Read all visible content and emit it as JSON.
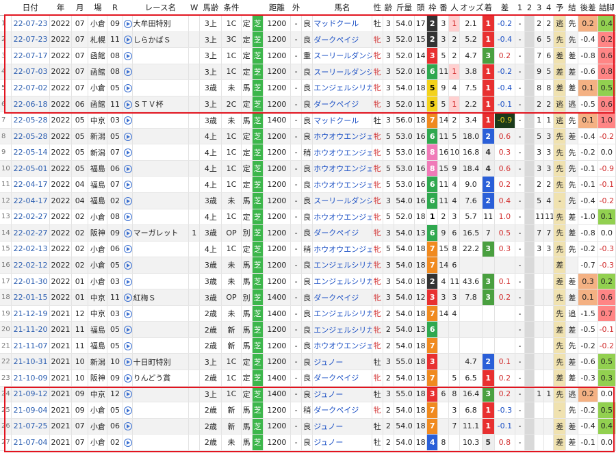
{
  "columns": [
    "",
    "日付",
    "年",
    "月",
    "場",
    "R",
    "",
    "レース名",
    "W",
    "馬齢",
    "条件",
    "",
    "",
    "距離",
    "外",
    "",
    "馬名",
    "性",
    "齢",
    "斤量",
    "頭",
    "枠",
    "番",
    "人",
    "オッズ",
    "着",
    "差",
    "1",
    "2",
    "3",
    "4",
    "予",
    "結",
    "後差",
    "詰脚"
  ],
  "frame_colors": {
    "1": "#ffffff",
    "2": "#333333",
    "3": "#e83030",
    "4": "#2a5fd8",
    "5": "#f3d21c",
    "6": "#2fa84f",
    "7": "#f08a20",
    "8": "#f07ab8"
  },
  "finish_colors": {
    "1": "#e83030",
    "2": "#2a5fd8",
    "3": "#4aa040",
    "4": "#eeeeee",
    "5": "#eeeeee"
  },
  "rows": [
    {
      "n": "1",
      "date": "22-07-23",
      "y": "2022",
      "m": "07",
      "place": "小倉",
      "r": "09",
      "race": "大牟田特別",
      "w": "",
      "age": "3上",
      "cls": "1C",
      "t1": "定",
      "t2": "芝",
      "dist": "1200",
      "out": "-",
      "cond": "良",
      "horse": "マッドクール",
      "sex": "牡",
      "hage": "3",
      "kg": "54.0",
      "heads": "17",
      "frame": "2",
      "num": "3",
      "pop": "1",
      "odds": "2.1",
      "fin": "1",
      "diff": "-0.2",
      "c1": "-",
      "c2": "",
      "c3": "2",
      "c4": "2",
      "pred": "逃",
      "res": "先",
      "ato": "0.2",
      "ato_c": "#f4b183",
      "tsume": "0.4",
      "tsume_c": "#92d050"
    },
    {
      "n": "2",
      "date": "22-07-23",
      "y": "2022",
      "m": "07",
      "place": "札幌",
      "r": "11",
      "race": "しらかばＳ",
      "w": "",
      "age": "3上",
      "cls": "3C",
      "t1": "定",
      "t2": "芝",
      "dist": "1200",
      "out": "-",
      "cond": "良",
      "horse": "ダークペイジ",
      "sex": "牝",
      "hage": "3",
      "kg": "52.0",
      "heads": "15",
      "frame": "2",
      "num": "3",
      "pop": "2",
      "odds": "5.2",
      "fin": "1",
      "diff": "-0.4",
      "c1": "-",
      "c2": "",
      "c3": "6",
      "c4": "5",
      "pred": "先",
      "res": "先",
      "ato": "-0.4",
      "ato_c": "#ffffff",
      "tsume": "0.2",
      "tsume_c": "#ff8585"
    },
    {
      "n": "3",
      "date": "22-07-17",
      "y": "2022",
      "m": "07",
      "place": "函館",
      "r": "08",
      "race": "",
      "w": "",
      "age": "3上",
      "cls": "1C",
      "t1": "定",
      "t2": "芝",
      "dist": "1200",
      "out": "-",
      "cond": "重",
      "horse": "スーリールダンジュ",
      "sex": "牝",
      "hage": "3",
      "kg": "52.0",
      "heads": "14",
      "frame": "3",
      "num": "5",
      "pop": "2",
      "odds": "4.7",
      "fin": "3",
      "diff": "0.2",
      "c1": "-",
      "c2": "",
      "c3": "7",
      "c4": "6",
      "pred": "差",
      "res": "差",
      "ato": "-0.8",
      "ato_c": "#ffffff",
      "tsume": "0.6",
      "tsume_c": "#ff8585"
    },
    {
      "n": "4",
      "date": "22-07-03",
      "y": "2022",
      "m": "07",
      "place": "函館",
      "r": "08",
      "race": "",
      "w": "",
      "age": "3上",
      "cls": "1C",
      "t1": "定",
      "t2": "芝",
      "dist": "1200",
      "out": "-",
      "cond": "良",
      "horse": "スーリールダンジュ",
      "sex": "牝",
      "hage": "3",
      "kg": "52.0",
      "heads": "16",
      "frame": "6",
      "num": "11",
      "pop": "1",
      "odds": "3.8",
      "fin": "1",
      "diff": "-0.2",
      "c1": "-",
      "c2": "",
      "c3": "9",
      "c4": "5",
      "pred": "差",
      "res": "差",
      "ato": "-0.6",
      "ato_c": "#ffffff",
      "tsume": "0.8",
      "tsume_c": "#ff8585"
    },
    {
      "n": "5",
      "date": "22-07-02",
      "y": "2022",
      "m": "07",
      "place": "小倉",
      "r": "05",
      "race": "",
      "w": "",
      "age": "3歳",
      "cls": "未",
      "t1": "馬",
      "t2": "芝",
      "dist": "1200",
      "out": "-",
      "cond": "良",
      "horse": "エンジェルシリカ",
      "sex": "牝",
      "hage": "3",
      "kg": "54.0",
      "heads": "18",
      "frame": "5",
      "num": "9",
      "pop": "4",
      "odds": "7.5",
      "fin": "1",
      "diff": "-0.4",
      "c1": "-",
      "c2": "",
      "c3": "8",
      "c4": "8",
      "pred": "差",
      "res": "差",
      "ato": "0.1",
      "ato_c": "#f4b183",
      "tsume": "0.5",
      "tsume_c": "#92d050"
    },
    {
      "n": "6",
      "date": "22-06-18",
      "y": "2022",
      "m": "06",
      "place": "函館",
      "r": "11",
      "race": "ＳＴＶ杯",
      "w": "",
      "age": "3上",
      "cls": "2C",
      "t1": "定",
      "t2": "芝",
      "dist": "1200",
      "out": "-",
      "cond": "良",
      "horse": "ダークペイジ",
      "sex": "牝",
      "hage": "3",
      "kg": "52.0",
      "heads": "11",
      "frame": "5",
      "num": "5",
      "pop": "1",
      "odds": "2.2",
      "fin": "1",
      "diff": "-0.1",
      "c1": "-",
      "c2": "",
      "c3": "2",
      "c4": "2",
      "pred": "逃",
      "res": "逃",
      "ato": "-0.5",
      "ato_c": "#ffffff",
      "tsume": "0.6",
      "tsume_c": "#ff8585"
    },
    {
      "n": "7",
      "date": "22-05-28",
      "y": "2022",
      "m": "05",
      "place": "中京",
      "r": "03",
      "race": "",
      "w": "",
      "age": "3歳",
      "cls": "未",
      "t1": "馬",
      "t2": "芝",
      "dist": "1400",
      "out": "-",
      "cond": "良",
      "horse": "マッドクール",
      "sex": "牡",
      "hage": "3",
      "kg": "56.0",
      "heads": "18",
      "frame": "7",
      "num": "14",
      "pop": "2",
      "odds": "3.4",
      "fin": "1",
      "diff": "-0.9",
      "c1": "-",
      "c2": "",
      "c3": "1",
      "c4": "1",
      "pred": "逃",
      "res": "先",
      "ato": "0.1",
      "ato_c": "#f4b183",
      "tsume": "1.0",
      "tsume_c": "#ff8585"
    },
    {
      "n": "8",
      "date": "22-05-28",
      "y": "2022",
      "m": "05",
      "place": "新潟",
      "r": "05",
      "race": "",
      "w": "",
      "age": "4上",
      "cls": "1C",
      "t1": "定",
      "t2": "芝",
      "dist": "1200",
      "out": "-",
      "cond": "良",
      "horse": "ホウオウエンジェル",
      "sex": "牝",
      "hage": "5",
      "kg": "53.0",
      "heads": "16",
      "frame": "6",
      "num": "11",
      "pop": "5",
      "odds": "18.0",
      "fin": "2",
      "diff": "0.6",
      "c1": "-",
      "c2": "",
      "c3": "5",
      "c4": "3",
      "pred": "先",
      "res": "差",
      "ato": "-0.4",
      "ato_c": "#ffffff",
      "tsume": "-0.2",
      "tsume_c": "#ffffff"
    },
    {
      "n": "9",
      "date": "22-05-14",
      "y": "2022",
      "m": "05",
      "place": "新潟",
      "r": "07",
      "race": "",
      "w": "",
      "age": "4上",
      "cls": "1C",
      "t1": "定",
      "t2": "芝",
      "dist": "1200",
      "out": "-",
      "cond": "稍",
      "horse": "ホウオウエンジェル",
      "sex": "牝",
      "hage": "5",
      "kg": "53.0",
      "heads": "16",
      "frame": "8",
      "num": "16",
      "pop": "10",
      "odds": "16.8",
      "fin": "4",
      "diff": "0.3",
      "c1": "-",
      "c2": "",
      "c3": "3",
      "c4": "3",
      "pred": "先",
      "res": "先",
      "ato": "-0.2",
      "ato_c": "#ffffff",
      "tsume": "0.0",
      "tsume_c": "#ffffff"
    },
    {
      "n": "10",
      "date": "22-05-01",
      "y": "2022",
      "m": "05",
      "place": "福島",
      "r": "06",
      "race": "",
      "w": "",
      "age": "4上",
      "cls": "1C",
      "t1": "定",
      "t2": "芝",
      "dist": "1200",
      "out": "-",
      "cond": "良",
      "horse": "ホウオウエンジェル",
      "sex": "牝",
      "hage": "5",
      "kg": "53.0",
      "heads": "16",
      "frame": "8",
      "num": "15",
      "pop": "9",
      "odds": "18.4",
      "fin": "4",
      "diff": "0.6",
      "c1": "-",
      "c2": "",
      "c3": "3",
      "c4": "3",
      "pred": "先",
      "res": "先",
      "ato": "-0.1",
      "ato_c": "#ffffff",
      "tsume": "-0.9",
      "tsume_c": "#ffffff"
    },
    {
      "n": "11",
      "date": "22-04-17",
      "y": "2022",
      "m": "04",
      "place": "福島",
      "r": "07",
      "race": "",
      "w": "",
      "age": "4上",
      "cls": "1C",
      "t1": "定",
      "t2": "芝",
      "dist": "1200",
      "out": "-",
      "cond": "良",
      "horse": "ホウオウエンジェル",
      "sex": "牝",
      "hage": "5",
      "kg": "53.0",
      "heads": "16",
      "frame": "6",
      "num": "11",
      "pop": "4",
      "odds": "9.0",
      "fin": "2",
      "diff": "0.2",
      "c1": "-",
      "c2": "",
      "c3": "2",
      "c4": "2",
      "pred": "先",
      "res": "先",
      "ato": "-0.1",
      "ato_c": "#ffffff",
      "tsume": "-0.1",
      "tsume_c": "#ffffff"
    },
    {
      "n": "12",
      "date": "22-04-17",
      "y": "2022",
      "m": "04",
      "place": "福島",
      "r": "02",
      "race": "",
      "w": "",
      "age": "3歳",
      "cls": "未",
      "t1": "馬",
      "t2": "芝",
      "dist": "1200",
      "out": "-",
      "cond": "良",
      "horse": "スーリールダンジュ",
      "sex": "牝",
      "hage": "3",
      "kg": "54.0",
      "heads": "16",
      "frame": "6",
      "num": "11",
      "pop": "4",
      "odds": "7.6",
      "fin": "2",
      "diff": "0.4",
      "c1": "-",
      "c2": "",
      "c3": "5",
      "c4": "4",
      "pred": "-",
      "res": "先",
      "ato": "-0.4",
      "ato_c": "#ffffff",
      "tsume": "-0.2",
      "tsume_c": "#ffffff"
    },
    {
      "n": "13",
      "date": "22-02-27",
      "y": "2022",
      "m": "02",
      "place": "小倉",
      "r": "08",
      "race": "",
      "w": "",
      "age": "4上",
      "cls": "1C",
      "t1": "定",
      "t2": "芝",
      "dist": "1200",
      "out": "-",
      "cond": "良",
      "horse": "ホウオウエンジェル",
      "sex": "牝",
      "hage": "5",
      "kg": "52.0",
      "heads": "18",
      "frame": "1",
      "num": "2",
      "pop": "3",
      "odds": "5.7",
      "fin": "11",
      "diff": "1.0",
      "c1": "-",
      "c2": "",
      "c3": "11",
      "c4": "11",
      "pred": "先",
      "res": "差",
      "ato": "-1.0",
      "ato_c": "#ffffff",
      "tsume": "0.1",
      "tsume_c": "#92d050"
    },
    {
      "n": "14",
      "date": "22-02-27",
      "y": "2022",
      "m": "02",
      "place": "阪神",
      "r": "09",
      "race": "マーガレット",
      "w": "1",
      "age": "3歳",
      "cls": "OP",
      "t1": "別",
      "t2": "芝",
      "dist": "1200",
      "out": "-",
      "cond": "良",
      "horse": "ダークペイジ",
      "sex": "牝",
      "hage": "3",
      "kg": "54.0",
      "heads": "13",
      "frame": "6",
      "num": "9",
      "pop": "6",
      "odds": "16.5",
      "fin": "7",
      "diff": "0.5",
      "c1": "-",
      "c2": "",
      "c3": "7",
      "c4": "7",
      "pred": "先",
      "res": "差",
      "ato": "-0.8",
      "ato_c": "#ffffff",
      "tsume": "0.0",
      "tsume_c": "#ffffff"
    },
    {
      "n": "15",
      "date": "22-02-13",
      "y": "2022",
      "m": "02",
      "place": "小倉",
      "r": "06",
      "race": "",
      "w": "",
      "age": "4上",
      "cls": "1C",
      "t1": "定",
      "t2": "芝",
      "dist": "1200",
      "out": "-",
      "cond": "稍",
      "horse": "ホウオウエンジェル",
      "sex": "牝",
      "hage": "5",
      "kg": "54.0",
      "heads": "18",
      "frame": "7",
      "num": "15",
      "pop": "8",
      "odds": "22.2",
      "fin": "3",
      "diff": "0.3",
      "c1": "-",
      "c2": "",
      "c3": "3",
      "c4": "3",
      "pred": "先",
      "res": "先",
      "ato": "-0.2",
      "ato_c": "#ffffff",
      "tsume": "-0.3",
      "tsume_c": "#ffffff"
    },
    {
      "n": "16",
      "date": "22-02-12",
      "y": "2022",
      "m": "02",
      "place": "小倉",
      "r": "05",
      "race": "",
      "w": "",
      "age": "3歳",
      "cls": "未",
      "t1": "馬",
      "t2": "芝",
      "dist": "1200",
      "out": "-",
      "cond": "良",
      "horse": "エンジェルシリカ",
      "sex": "牝",
      "hage": "3",
      "kg": "54.0",
      "heads": "18",
      "frame": "7",
      "num": "14",
      "pop": "6",
      "odds": "",
      "fin": "",
      "diff": "",
      "c1": "-",
      "c2": "",
      "c3": "",
      "c4": "",
      "pred": "差",
      "res": "",
      "ato": "-0.7",
      "ato_c": "#ffffff",
      "tsume": "-0.3",
      "tsume_c": "#ffffff"
    },
    {
      "n": "17",
      "date": "22-01-30",
      "y": "2022",
      "m": "01",
      "place": "小倉",
      "r": "03",
      "race": "",
      "w": "",
      "age": "3歳",
      "cls": "未",
      "t1": "馬",
      "t2": "芝",
      "dist": "1200",
      "out": "-",
      "cond": "良",
      "horse": "エンジェルシリカ",
      "sex": "牝",
      "hage": "3",
      "kg": "54.0",
      "heads": "18",
      "frame": "2",
      "num": "4",
      "pop": "11",
      "odds": "43.6",
      "fin": "3",
      "diff": "0.1",
      "c1": "-",
      "c2": "",
      "c3": "",
      "c4": "",
      "pred": "差",
      "res": "差",
      "ato": "0.3",
      "ato_c": "#f4b183",
      "tsume": "0.2",
      "tsume_c": "#92d050"
    },
    {
      "n": "18",
      "date": "22-01-15",
      "y": "2022",
      "m": "01",
      "place": "中京",
      "r": "11",
      "race": "紅梅Ｓ",
      "w": "",
      "age": "3歳",
      "cls": "OP",
      "t1": "別",
      "t2": "芝",
      "dist": "1400",
      "out": "-",
      "cond": "良",
      "horse": "ダークペイジ",
      "sex": "牝",
      "hage": "3",
      "kg": "54.0",
      "heads": "12",
      "frame": "3",
      "num": "3",
      "pop": "3",
      "odds": "7.8",
      "fin": "3",
      "diff": "0.2",
      "c1": "-",
      "c2": "",
      "c3": "",
      "c4": "",
      "pred": "先",
      "res": "差",
      "ato": "0.1",
      "ato_c": "#f4b183",
      "tsume": "0.6",
      "tsume_c": "#ff8585"
    },
    {
      "n": "19",
      "date": "21-12-19",
      "y": "2021",
      "m": "12",
      "place": "中京",
      "r": "03",
      "race": "",
      "w": "",
      "age": "2歳",
      "cls": "未",
      "t1": "馬",
      "t2": "芝",
      "dist": "1400",
      "out": "-",
      "cond": "良",
      "horse": "エンジェルシリカ",
      "sex": "牝",
      "hage": "2",
      "kg": "54.0",
      "heads": "18",
      "frame": "7",
      "num": "14",
      "pop": "4",
      "odds": "",
      "fin": "",
      "diff": "",
      "c1": "-",
      "c2": "",
      "c3": "",
      "c4": "",
      "pred": "先",
      "res": "追",
      "ato": "-1.5",
      "ato_c": "#ffffff",
      "tsume": "0.7",
      "tsume_c": "#ff8585"
    },
    {
      "n": "20",
      "date": "21-11-20",
      "y": "2021",
      "m": "11",
      "place": "福島",
      "r": "05",
      "race": "",
      "w": "",
      "age": "2歳",
      "cls": "新",
      "t1": "馬",
      "t2": "芝",
      "dist": "1200",
      "out": "-",
      "cond": "良",
      "horse": "エンジェルシリカ",
      "sex": "牝",
      "hage": "2",
      "kg": "54.0",
      "heads": "13",
      "frame": "6",
      "num": "",
      "pop": "",
      "odds": "",
      "fin": "",
      "diff": "",
      "c1": "-",
      "c2": "",
      "c3": "",
      "c4": "",
      "pred": "差",
      "res": "差",
      "ato": "-0.5",
      "ato_c": "#ffffff",
      "tsume": "-0.1",
      "tsume_c": "#ffffff"
    },
    {
      "n": "21",
      "date": "21-11-07",
      "y": "2021",
      "m": "11",
      "place": "福島",
      "r": "05",
      "race": "",
      "w": "",
      "age": "2歳",
      "cls": "新",
      "t1": "馬",
      "t2": "芝",
      "dist": "1200",
      "out": "-",
      "cond": "良",
      "horse": "ホウオウエンジェル",
      "sex": "牝",
      "hage": "2",
      "kg": "54.0",
      "heads": "18",
      "frame": "7",
      "num": "",
      "pop": "",
      "odds": "",
      "fin": "",
      "diff": "",
      "c1": "-",
      "c2": "",
      "c3": "",
      "c4": "",
      "pred": "先",
      "res": "先",
      "ato": "-0.2",
      "ato_c": "#ffffff",
      "tsume": "-0.2",
      "tsume_c": "#ffffff"
    },
    {
      "n": "22",
      "date": "21-10-31",
      "y": "2021",
      "m": "10",
      "place": "新潟",
      "r": "10",
      "race": "十日町特別",
      "w": "",
      "age": "3上",
      "cls": "1C",
      "t1": "定",
      "t2": "芝",
      "dist": "1200",
      "out": "-",
      "cond": "良",
      "horse": "ジュノー",
      "sex": "牡",
      "hage": "3",
      "kg": "55.0",
      "heads": "18",
      "frame": "3",
      "num": "",
      "pop": "",
      "odds": "4.7",
      "fin": "2",
      "diff": "0.1",
      "c1": "-",
      "c2": "",
      "c3": "",
      "c4": "",
      "pred": "先",
      "res": "差",
      "ato": "-0.6",
      "ato_c": "#ffffff",
      "tsume": "0.5",
      "tsume_c": "#92d050"
    },
    {
      "n": "23",
      "date": "21-10-09",
      "y": "2021",
      "m": "10",
      "place": "阪神",
      "r": "09",
      "race": "りんどう賞",
      "w": "",
      "age": "2歳",
      "cls": "1C",
      "t1": "定",
      "t2": "芝",
      "dist": "1400",
      "out": "-",
      "cond": "良",
      "horse": "ダークペイジ",
      "sex": "牝",
      "hage": "2",
      "kg": "54.0",
      "heads": "13",
      "frame": "7",
      "num": "",
      "pop": "5",
      "odds": "6.5",
      "fin": "1",
      "diff": "0.2",
      "c1": "-",
      "c2": "",
      "c3": "",
      "c4": "",
      "pred": "差",
      "res": "差",
      "ato": "-0.3",
      "ato_c": "#ffffff",
      "tsume": "0.3",
      "tsume_c": "#92d050"
    },
    {
      "n": "24",
      "date": "21-09-12",
      "y": "2021",
      "m": "09",
      "place": "中京",
      "r": "12",
      "race": "",
      "w": "",
      "age": "3上",
      "cls": "1C",
      "t1": "定",
      "t2": "芝",
      "dist": "1400",
      "out": "-",
      "cond": "良",
      "horse": "ジュノー",
      "sex": "牡",
      "hage": "3",
      "kg": "55.0",
      "heads": "18",
      "frame": "3",
      "num": "6",
      "pop": "8",
      "odds": "16.4",
      "fin": "3",
      "diff": "0.2",
      "c1": "-",
      "c2": "",
      "c3": "1",
      "c4": "1",
      "pred": "先",
      "res": "逃",
      "ato": "0.2",
      "ato_c": "#f4b183",
      "tsume": "0.0",
      "tsume_c": "#ffffff"
    },
    {
      "n": "25",
      "date": "21-09-04",
      "y": "2021",
      "m": "09",
      "place": "小倉",
      "r": "05",
      "race": "",
      "w": "",
      "age": "2歳",
      "cls": "新",
      "t1": "馬",
      "t2": "芝",
      "dist": "1200",
      "out": "-",
      "cond": "稍",
      "horse": "ダークペイジ",
      "sex": "牝",
      "hage": "2",
      "kg": "54.0",
      "heads": "18",
      "frame": "7",
      "num": "",
      "pop": "3",
      "odds": "6.8",
      "fin": "1",
      "diff": "-0.3",
      "c1": "-",
      "c2": "",
      "c3": "",
      "c4": "",
      "pred": "-",
      "res": "先",
      "ato": "-0.2",
      "ato_c": "#ffffff",
      "tsume": "0.5",
      "tsume_c": "#92d050"
    },
    {
      "n": "26",
      "date": "21-07-25",
      "y": "2021",
      "m": "07",
      "place": "小倉",
      "r": "06",
      "race": "",
      "w": "",
      "age": "2歳",
      "cls": "新",
      "t1": "馬",
      "t2": "芝",
      "dist": "1200",
      "out": "-",
      "cond": "良",
      "horse": "ジュノー",
      "sex": "牡",
      "hage": "2",
      "kg": "54.0",
      "heads": "18",
      "frame": "7",
      "num": "",
      "pop": "7",
      "odds": "11.1",
      "fin": "1",
      "diff": "-0.1",
      "c1": "-",
      "c2": "",
      "c3": "",
      "c4": "",
      "pred": "差",
      "res": "差",
      "ato": "-0.4",
      "ato_c": "#ffffff",
      "tsume": "0.4",
      "tsume_c": "#92d050"
    },
    {
      "n": "27",
      "date": "21-07-04",
      "y": "2021",
      "m": "07",
      "place": "小倉",
      "r": "02",
      "race": "",
      "w": "",
      "age": "2歳",
      "cls": "未",
      "t1": "馬",
      "t2": "芝",
      "dist": "1200",
      "out": "-",
      "cond": "良",
      "horse": "ジュノー",
      "sex": "牡",
      "hage": "2",
      "kg": "54.0",
      "heads": "18",
      "frame": "4",
      "num": "8",
      "pop": "",
      "odds": "10.3",
      "fin": "5",
      "diff": "0.8",
      "c1": "-",
      "c2": "",
      "c3": "",
      "c4": "",
      "pred": "差",
      "res": "差",
      "ato": "-0.1",
      "ato_c": "#ffffff",
      "tsume": "0.0",
      "tsume_c": "#ffffff"
    }
  ]
}
